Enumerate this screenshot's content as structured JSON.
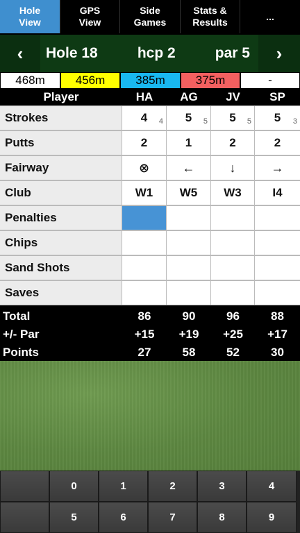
{
  "tabs": [
    {
      "label": "Hole\nView",
      "active": true
    },
    {
      "label": "GPS\nView",
      "active": false
    },
    {
      "label": "Side\nGames",
      "active": false
    },
    {
      "label": "Stats &\nResults",
      "active": false
    },
    {
      "label": "...",
      "active": false
    }
  ],
  "hole": {
    "prev_icon": "chevron-left",
    "next_icon": "chevron-right",
    "title": "Hole 18",
    "hcp": "hcp 2",
    "par": "par 5"
  },
  "distances": [
    {
      "value": "468m",
      "color": "#ffffff"
    },
    {
      "value": "456m",
      "color": "#ffff00"
    },
    {
      "value": "385m",
      "color": "#19b8f0"
    },
    {
      "value": "375m",
      "color": "#f36060"
    },
    {
      "value": "-",
      "color": "#ffffff"
    }
  ],
  "table": {
    "player_header": "Player",
    "players": [
      "HA",
      "AG",
      "JV",
      "SP"
    ],
    "rows": [
      {
        "label": "Strokes",
        "cells": [
          {
            "v": "4",
            "sub": "4"
          },
          {
            "v": "5",
            "sub": "5"
          },
          {
            "v": "5",
            "sub": "5"
          },
          {
            "v": "5",
            "sub": "3"
          }
        ]
      },
      {
        "label": "Putts",
        "cells": [
          {
            "v": "2"
          },
          {
            "v": "1"
          },
          {
            "v": "2"
          },
          {
            "v": "2"
          }
        ]
      },
      {
        "label": "Fairway",
        "cells": [
          {
            "v": "⊗"
          },
          {
            "v": "←"
          },
          {
            "v": "↓"
          },
          {
            "v": "→"
          }
        ]
      },
      {
        "label": "Club",
        "cells": [
          {
            "v": "W1"
          },
          {
            "v": "W5"
          },
          {
            "v": "W3"
          },
          {
            "v": "I4"
          }
        ]
      },
      {
        "label": "Penalties",
        "cells": [
          {
            "v": "",
            "selected": true
          },
          {
            "v": ""
          },
          {
            "v": ""
          },
          {
            "v": ""
          }
        ]
      },
      {
        "label": "Chips",
        "cells": [
          {
            "v": ""
          },
          {
            "v": ""
          },
          {
            "v": ""
          },
          {
            "v": ""
          }
        ]
      },
      {
        "label": "Sand Shots",
        "cells": [
          {
            "v": ""
          },
          {
            "v": ""
          },
          {
            "v": ""
          },
          {
            "v": ""
          }
        ]
      },
      {
        "label": "Saves",
        "cells": [
          {
            "v": ""
          },
          {
            "v": ""
          },
          {
            "v": ""
          },
          {
            "v": ""
          }
        ]
      }
    ]
  },
  "totals": [
    {
      "label": "Total",
      "values": [
        "86",
        "90",
        "96",
        "88"
      ]
    },
    {
      "label": "+/- Par",
      "values": [
        "+15",
        "+19",
        "+25",
        "+17"
      ]
    },
    {
      "label": "Points",
      "values": [
        "27",
        "58",
        "52",
        "30"
      ]
    }
  ],
  "keypad": {
    "row1": [
      "",
      "0",
      "1",
      "2",
      "3",
      "4"
    ],
    "row2": [
      "",
      "5",
      "6",
      "7",
      "8",
      "9"
    ]
  },
  "colors": {
    "selected": "#4793d5",
    "tab_active": "#3f8fcf",
    "hole_bar": "#0e3a14"
  }
}
